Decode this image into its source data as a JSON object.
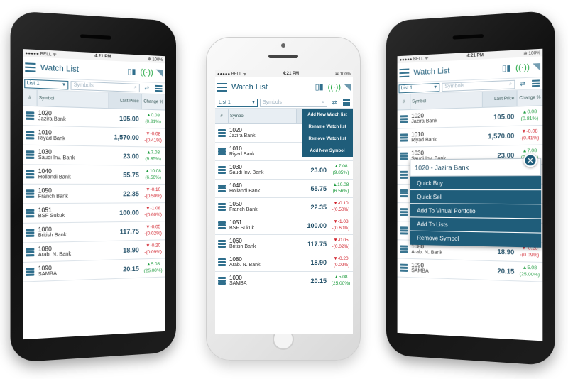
{
  "status": {
    "carrier": "●●●●● BELL ᯤ",
    "time": "4:21 PM",
    "battery": "✻ 100%"
  },
  "header": {
    "title": "Watch List",
    "icons": [
      "menu-icon",
      "phone-tablet-icon",
      "signal-tower-icon"
    ]
  },
  "toolbar": {
    "list_value": "List 1",
    "search_placeholder": "Symbols",
    "search_icon": "search-icon",
    "refresh_icon": "⇄"
  },
  "columns": {
    "hash": "#",
    "symbol": "Symbol",
    "last_price": "Last Price",
    "change": "Change %"
  },
  "rows": [
    {
      "code": "1020",
      "name": "Jazira Bank",
      "price": "105.00",
      "chg1": "▲0.08",
      "chg2": "(0.81%)",
      "dir": "up"
    },
    {
      "code": "1010",
      "name": "Riyad Bank",
      "price": "1,570.00",
      "chg1": "▼-0.08",
      "chg2": "-(0.41%)",
      "dir": "down"
    },
    {
      "code": "1030",
      "name": "Saudi Inv. Bank",
      "price": "23.00",
      "chg1": "▲7.08",
      "chg2": "(9.85%)",
      "dir": "up"
    },
    {
      "code": "1040",
      "name": "Hollandi Bank",
      "price": "55.75",
      "chg1": "▲10.08",
      "chg2": "(6.56%)",
      "dir": "up"
    },
    {
      "code": "1050",
      "name": "Franch Bank",
      "price": "22.35",
      "chg1": "▼-0.10",
      "chg2": "-(0.50%)",
      "dir": "down"
    },
    {
      "code": "1051",
      "name": "BSF Sukuk",
      "price": "100.00",
      "chg1": "▼-1.08",
      "chg2": "-(0.60%)",
      "dir": "down"
    },
    {
      "code": "1060",
      "name": "British Bank",
      "price": "117.75",
      "chg1": "▼-0.05",
      "chg2": "-(0.02%)",
      "dir": "down"
    },
    {
      "code": "1080",
      "name": "Arab. N. Bank",
      "price": "18.90",
      "chg1": "▼-0.20",
      "chg2": "-(0.09%)",
      "dir": "down"
    },
    {
      "code": "1090",
      "name": "SAMBA",
      "price": "20.15",
      "chg1": "▲5.08",
      "chg2": "(25.00%)",
      "dir": "up"
    }
  ],
  "dropdown": [
    "Add New Watch list",
    "Rename Watch list",
    "Remove Watch list",
    "Add New Symbol"
  ],
  "popup": {
    "title": "1020 - Jazira Bank",
    "close_label": "✕",
    "items": [
      "Quick Buy",
      "Quick Sell",
      "Add To Virtual Portfolio",
      "Add To Lists",
      "Remove Symbol"
    ]
  },
  "colors": {
    "accent": "#1f5d7a",
    "up": "#1a9a3b",
    "down": "#d0202a"
  }
}
